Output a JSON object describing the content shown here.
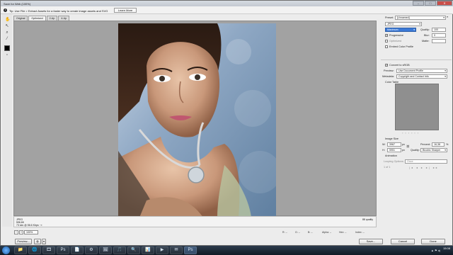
{
  "window": {
    "title": "Save for Web (100%)",
    "controls": [
      "–",
      "□",
      "✕"
    ]
  },
  "tip": {
    "text": "Tip: Use File > Extract Assets for a faster way to create image assets and SVG",
    "learn_label": "Learn More"
  },
  "tools": [
    {
      "name": "hand-tool-icon",
      "glyph": "✋"
    },
    {
      "name": "slice-select-tool-icon",
      "glyph": "↖"
    },
    {
      "name": "zoom-tool-icon",
      "glyph": "⌕"
    },
    {
      "name": "eyedropper-tool-icon",
      "glyph": "⁄"
    }
  ],
  "view_tabs": [
    "Original",
    "Optimized",
    "2-Up",
    "4-Up"
  ],
  "active_tab": "Optimized",
  "preview_info": {
    "line1": "JPEG",
    "line2": "596,6K",
    "line3": "73 sec @ 56.6 Kbps  ⁻≡",
    "quality": "88 quality"
  },
  "zoom": {
    "value": "100%"
  },
  "channels": {
    "r": "R: --",
    "g": "G: --",
    "b": "B: --",
    "alpha": "Alpha: --",
    "hex": "Hex: --",
    "index": "Index: --"
  },
  "buttons": {
    "preview": "Preview...",
    "save": "Save...",
    "cancel": "Cancel",
    "done": "Done"
  },
  "panel": {
    "preset_label": "Preset:",
    "preset_value": "[Unnamed]",
    "format_value": "JPEG",
    "compression_value": "Maximum",
    "quality_label": "Quality:",
    "quality_value": "100",
    "progressive_label": "Progressive",
    "blur_label": "Blur:",
    "blur_value": "0",
    "optimized_label": "Optimized",
    "matte_label": "Matte:",
    "embed_label": "Embed Color Profile",
    "convert_label": "Convert to sRGB",
    "preview_label": "Preview:",
    "preview_value": "Use Document Profile",
    "metadata_label": "Metadata:",
    "metadata_value": "Copyright and Contact Info",
    "color_table_label": "Color Table",
    "image_size_label": "Image Size",
    "w_label": "W:",
    "w_value": "3967",
    "h_label": "H:",
    "h_value": "5951",
    "unit_px": "px",
    "percent_label": "Percent:",
    "percent_value": "16,38",
    "percent_unit": "%",
    "quality_resample_label": "Quality:",
    "quality_resample_value": "Bicubic Sharper",
    "animation_label": "Animation",
    "looping_label": "Looping Options:",
    "looping_value": "Once",
    "frame_counter": "1 of 1"
  },
  "taskbar": {
    "apps": [
      "📁",
      "🌐",
      "🎞",
      "Ps",
      "📄",
      "⚙",
      "🖼",
      "🎵",
      "🔍",
      "📊",
      "▶",
      "✉",
      "Ps"
    ],
    "tray": "▲ ⚑ ◂)",
    "time": "15:08",
    "date": ""
  }
}
